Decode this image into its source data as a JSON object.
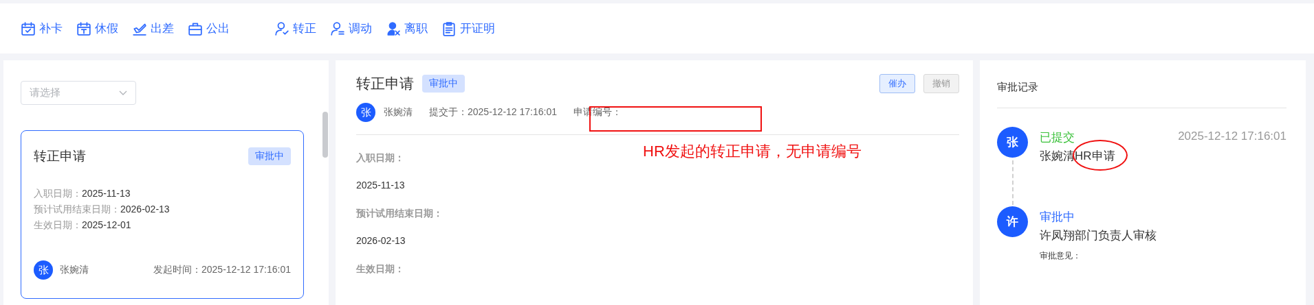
{
  "toolbar_groups": [
    {
      "items": [
        {
          "label": "补卡",
          "kind": "punch"
        },
        {
          "label": "休假",
          "kind": "leave"
        },
        {
          "label": "出差",
          "kind": "trip"
        },
        {
          "label": "公出",
          "kind": "outing"
        }
      ]
    },
    {
      "items": [
        {
          "label": "转正",
          "kind": "regular"
        },
        {
          "label": "调动",
          "kind": "transfer"
        },
        {
          "label": "离职",
          "kind": "resign"
        },
        {
          "label": "开证明",
          "kind": "certificate"
        }
      ]
    }
  ],
  "list": {
    "filter": {
      "placeholder": "请选择"
    },
    "cards": [
      {
        "title": "转正申请",
        "status": "审批中",
        "selected": true,
        "fields": [
          {
            "label": "入职日期：",
            "value": "2025-11-13"
          },
          {
            "label": "预计试用结束日期：",
            "value": "2026-02-13"
          },
          {
            "label": "生效日期：",
            "value": "2025-12-01"
          }
        ],
        "avatar": "张",
        "name": "张婉清",
        "time_label": "发起时间：",
        "time": "2025-12-12 17:16:01"
      }
    ]
  },
  "detail": {
    "title": "转正申请",
    "status": "审批中",
    "buttons": [
      {
        "label": "催办",
        "kind": "primary"
      },
      {
        "label": "撤销",
        "kind": "default"
      }
    ],
    "avatar": "张",
    "name": "张婉清",
    "submitted": "提交于：2025-12-12 17:16:01",
    "number_label": "申请编号：",
    "number_marked": true,
    "fields": [
      {
        "label": "入职日期：",
        "value": "2025-11-13"
      },
      {
        "label": "预计试用结束日期：",
        "value": "2026-02-13"
      },
      {
        "label": "生效日期："
      }
    ],
    "annotation": "HR发起的转正申请，无申请编号"
  },
  "record": {
    "title": "审批记录",
    "steps": [
      {
        "avatar": "张",
        "status": "已提交",
        "kind": "done",
        "time": "2025-12-12 17:16:01",
        "name": "张婉清",
        "detail": "HR申请",
        "circled": true
      },
      {
        "avatar": "许",
        "status": "审批中",
        "kind": "pending",
        "name": "许凤翔部门负责人审核",
        "circled": false,
        "opinion_label": "审批意见："
      }
    ]
  }
}
